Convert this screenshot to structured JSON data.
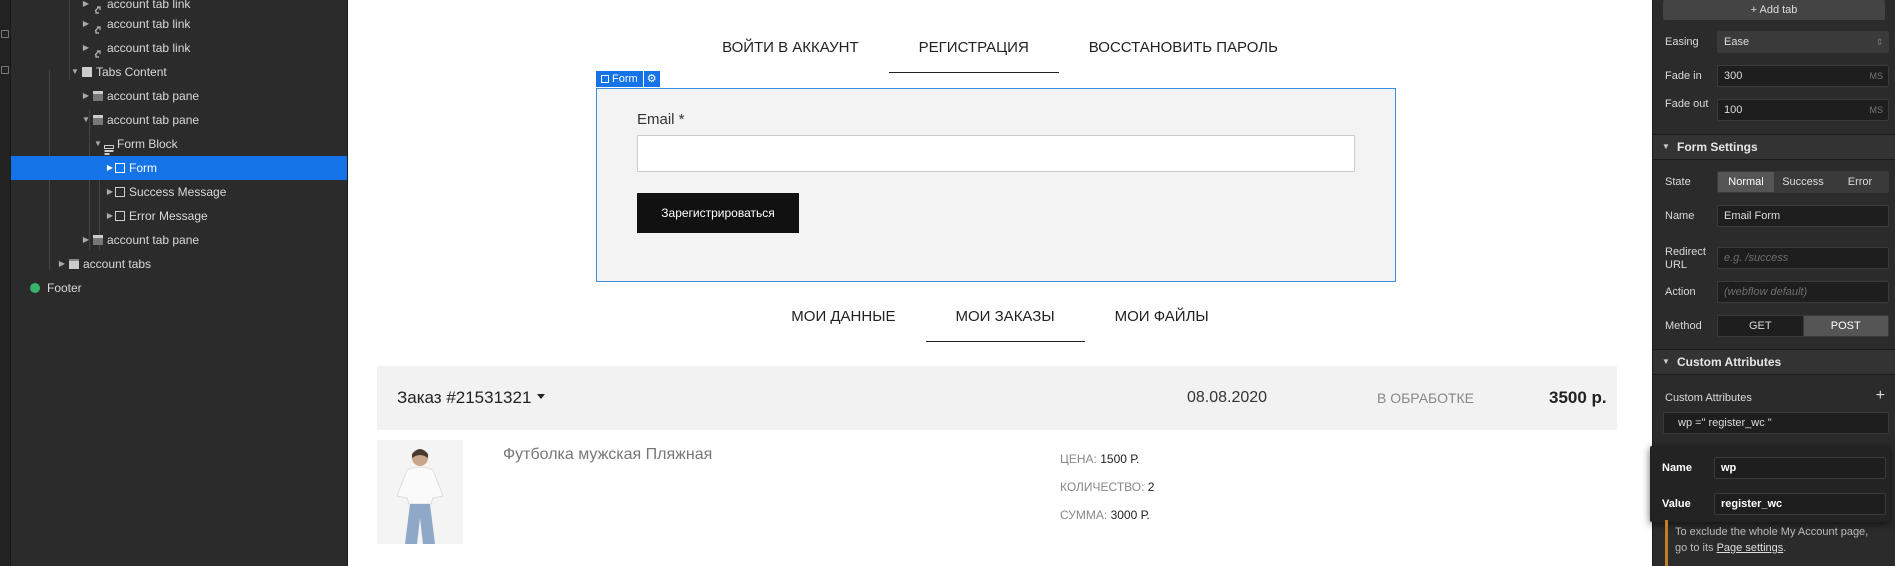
{
  "navigator": {
    "items": [
      {
        "label": "account tab link",
        "icon": "link-icon"
      },
      {
        "label": "account tab link",
        "icon": "link-icon"
      },
      {
        "label": "account tab link",
        "icon": "link-icon"
      },
      {
        "label": "Tabs Content",
        "icon": "tabs-content-icon"
      },
      {
        "label": "account tab pane",
        "icon": "tab-pane-icon"
      },
      {
        "label": "account tab pane",
        "icon": "tab-pane-icon"
      },
      {
        "label": "Form Block",
        "icon": "form-block-icon"
      },
      {
        "label": "Form",
        "icon": "form-icon"
      },
      {
        "label": "Success Message",
        "icon": "square-icon"
      },
      {
        "label": "Error Message",
        "icon": "square-icon"
      },
      {
        "label": "account tab pane",
        "icon": "tab-pane-icon"
      },
      {
        "label": "account tabs",
        "icon": "tabs-icon"
      },
      {
        "label": "Footer",
        "icon": "symbol-icon"
      }
    ]
  },
  "canvas": {
    "account_tabs": [
      "ВОЙТИ В АККАУНТ",
      "РЕГИСТРАЦИЯ",
      "ВОССТАНОВИТЬ ПАРОЛЬ"
    ],
    "form_label": "Form",
    "email_label": "Email *",
    "register_button": "Зарегистрироваться",
    "profile_tabs": [
      "МОИ ДАННЫЕ",
      "МОИ ЗАКАЗЫ",
      "МОИ ФАЙЛЫ"
    ],
    "order": {
      "number": "Заказ #21531321",
      "date": "08.08.2020",
      "status": "В ОБРАБОТКЕ",
      "total": "3500 р."
    },
    "product": {
      "name": "Футболка мужская Пляжная",
      "price_label": "ЦЕНА:",
      "price_value": "1500 Р.",
      "qty_label": "КОЛИЧЕСТВО:",
      "qty_value": "2",
      "sum_label": "СУММА:",
      "sum_value": "3000 Р."
    }
  },
  "panel": {
    "add_tab": "Add tab",
    "easing_label": "Easing",
    "easing_value": "Ease",
    "fade_in_label": "Fade in",
    "fade_in_value": "300",
    "fade_out_label": "Fade out",
    "fade_out_value": "100",
    "unit": "MS",
    "form_settings_title": "Form Settings",
    "state_label": "State",
    "state_options": [
      "Normal",
      "Success",
      "Error"
    ],
    "name_label": "Name",
    "name_value": "Email Form",
    "redirect_label": "Redirect URL",
    "redirect_placeholder": "e.g. /success",
    "action_label": "Action",
    "action_placeholder": "(webflow default)",
    "method_label": "Method",
    "method_options": [
      "GET",
      "POST"
    ],
    "custom_attributes_title": "Custom Attributes",
    "custom_attributes_label": "Custom Attributes",
    "attribute_entry": "wp =\" register_wc \"",
    "popup_name_label": "Name",
    "popup_name_value": "wp",
    "popup_value_label": "Value",
    "popup_value_value": "register_wc",
    "help_text_1": "To exclude the whole My Account page, go to its",
    "help_link": "Page settings",
    "help_text_2": "."
  },
  "colors": {
    "accent": "#1473e6",
    "panel_bg": "#2b2b2b",
    "canvas_bg": "#ffffff",
    "button_dark": "#111111"
  }
}
